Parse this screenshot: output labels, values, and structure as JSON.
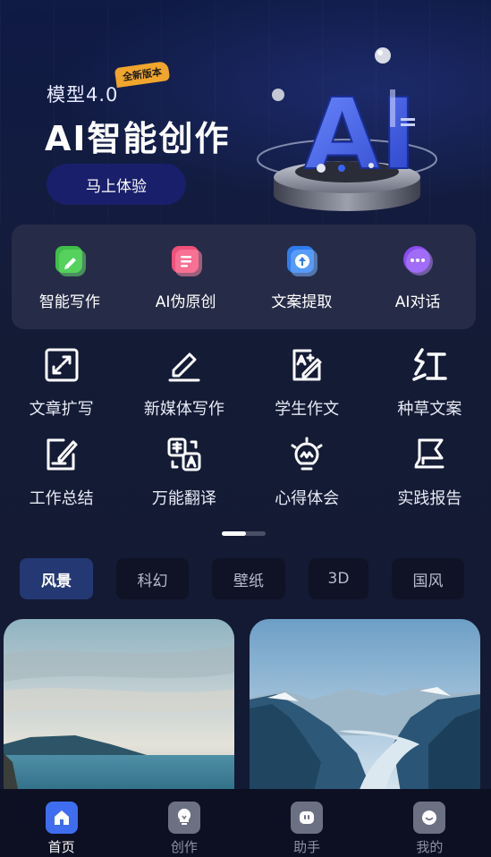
{
  "banner": {
    "subtitle": "模型4.0",
    "badge": "全新版本",
    "title": "AI智能创作",
    "cta": "马上体验",
    "art_text": "AI"
  },
  "quick_tools": [
    {
      "label": "智能写作",
      "icon": "pencil-icon",
      "color": "#3fbf4a"
    },
    {
      "label": "AI伪原创",
      "icon": "document-icon",
      "color": "#f0507a"
    },
    {
      "label": "文案提取",
      "icon": "upload-icon",
      "color": "#2f7cf0"
    },
    {
      "label": "AI对话",
      "icon": "chat-bubble-icon",
      "color": "#8a4cf0"
    }
  ],
  "tools_grid": [
    {
      "label": "文章扩写",
      "icon": "expand-icon"
    },
    {
      "label": "新媒体写作",
      "icon": "pen-icon"
    },
    {
      "label": "学生作文",
      "icon": "grade-edit-icon"
    },
    {
      "label": "种草文案",
      "icon": "red-text-icon"
    },
    {
      "label": "工作总结",
      "icon": "note-edit-icon"
    },
    {
      "label": "万能翻译",
      "icon": "translate-icon"
    },
    {
      "label": "心得体会",
      "icon": "lightbulb-icon"
    },
    {
      "label": "实践报告",
      "icon": "flag-icon"
    }
  ],
  "categories": [
    {
      "label": "风景",
      "active": true
    },
    {
      "label": "科幻",
      "active": false
    },
    {
      "label": "壁纸",
      "active": false
    },
    {
      "label": "3D",
      "active": false
    },
    {
      "label": "国风",
      "active": false
    }
  ],
  "tabbar": [
    {
      "label": "首页",
      "icon": "home-icon",
      "active": true
    },
    {
      "label": "创作",
      "icon": "bulb-icon",
      "active": false
    },
    {
      "label": "助手",
      "icon": "robot-icon",
      "active": false
    },
    {
      "label": "我的",
      "icon": "smile-icon",
      "active": false
    }
  ],
  "colors": {
    "background": "#131a33",
    "panel": "#262c47",
    "accent": "#3f6df0",
    "badge": "#f0a52c"
  }
}
